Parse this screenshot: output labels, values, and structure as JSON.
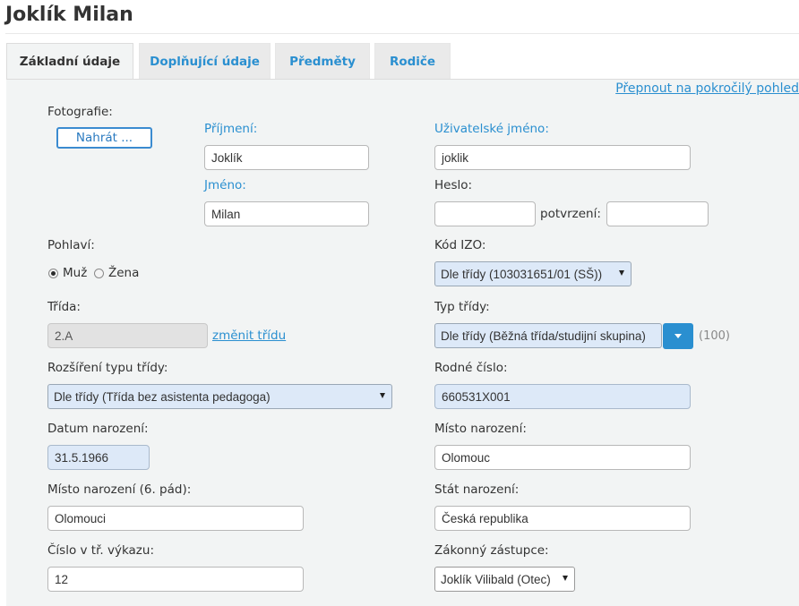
{
  "page": {
    "title": "Joklík Milan"
  },
  "tabs": [
    {
      "label": "Základní údaje",
      "active": true
    },
    {
      "label": "Doplňující údaje",
      "active": false
    },
    {
      "label": "Předměty",
      "active": false
    },
    {
      "label": "Rodiče",
      "active": false
    }
  ],
  "switch_view_link": "Přepnout na pokročilý pohled",
  "photo": {
    "label": "Fotografie:",
    "upload_button": "Nahrát ..."
  },
  "surname": {
    "label": "Příjmení:",
    "value": "Joklík"
  },
  "first_name": {
    "label": "Jméno:",
    "value": "Milan"
  },
  "username": {
    "label": "Uživatelské jméno:",
    "value": "joklik"
  },
  "password": {
    "label": "Heslo:",
    "value": "",
    "confirm_label": "potvrzení:",
    "confirm_value": ""
  },
  "gender": {
    "label": "Pohlaví:",
    "options": [
      {
        "label": "Muž",
        "checked": true
      },
      {
        "label": "Žena",
        "checked": false
      }
    ]
  },
  "izo": {
    "label": "Kód IZO:",
    "value": "Dle třídy (103031651/01 (SŠ))"
  },
  "class": {
    "label": "Třída:",
    "value": "2.A",
    "change_link": "změnit třídu"
  },
  "class_type": {
    "label": "Typ třídy:",
    "value": "Dle třídy (Běžná třída/studijní skupina)",
    "count": "(100)"
  },
  "class_type_ext": {
    "label": "Rozšíření typu třídy:",
    "value": "Dle třídy (Třída bez asistenta pedagoga)"
  },
  "birth_number": {
    "label": "Rodné číslo:",
    "value": "660531X001"
  },
  "birth_date": {
    "label": "Datum narození:",
    "value": "31.5.1966"
  },
  "birth_place": {
    "label": "Místo narození:",
    "value": "Olomouc"
  },
  "birth_place_locative": {
    "label": "Místo narození (6. pád):",
    "value": "Olomouci"
  },
  "birth_country": {
    "label": "Stát narození:",
    "value": "Česká republika"
  },
  "register_number": {
    "label": "Číslo v tř. výkazu:",
    "value": "12"
  },
  "guardian": {
    "label": "Zákonný zástupce:",
    "value": "Joklík Vilibald (Otec)"
  }
}
